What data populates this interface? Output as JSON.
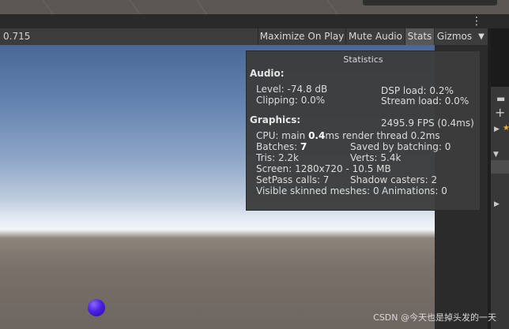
{
  "toolbar": {
    "scale_value": "0.715",
    "maximize_on_play": "Maximize On Play",
    "mute_audio": "Mute Audio",
    "stats": "Stats",
    "gizmos": "Gizmos",
    "dropdown_arrow": "▼"
  },
  "stats_panel": {
    "title": "Statistics",
    "audio_header": "Audio:",
    "level": "Level: -74.8 dB",
    "clipping": "Clipping: 0.0%",
    "dsp_load": "DSP load: 0.2%",
    "stream_load": "Stream load: 0.0%",
    "graphics_header": "Graphics:",
    "fps": "2495.9 FPS (0.4ms)",
    "cpu_prefix": "CPU: main ",
    "cpu_main_value": "0.4",
    "cpu_suffix": "ms  render thread 0.2ms",
    "batches_prefix": "Batches: ",
    "batches_value": "7",
    "saved_by_batching": "Saved by batching: 0",
    "tris": "Tris: 2.2k",
    "verts": "Verts: 5.4k",
    "screen": "Screen: 1280x720 - 10.5 MB",
    "setpass_calls": "SetPass calls: 7",
    "shadow_casters": "Shadow casters: 2",
    "visible_skinned_meshes": "Visible skinned meshes: 0",
    "animations": "Animations: 0"
  },
  "watermark": "CSDN @今天也是掉头发的一天",
  "icons": {
    "overflow": "⋮",
    "plus": "+",
    "folder": "▬",
    "star": "★",
    "arrow_right": "▶",
    "arrow_down": "▼"
  },
  "colors": {
    "sphere": "#4a1fe0",
    "toolbar_bg": "#3c3c3c",
    "active_button": "#575757",
    "panel_bg": "#3c3c3c"
  }
}
